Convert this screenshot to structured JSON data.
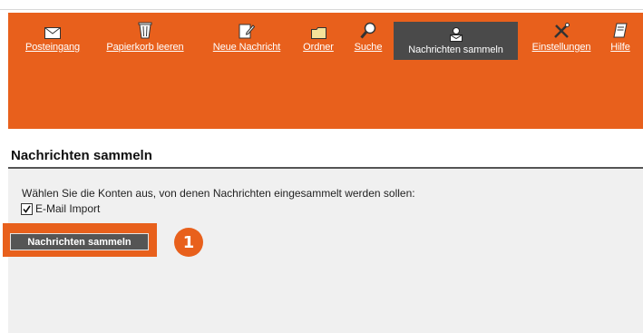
{
  "toolbar": {
    "items": [
      {
        "label": "Posteingang",
        "icon": "envelope-icon"
      },
      {
        "label": "Papierkorb leeren",
        "icon": "trash-icon"
      },
      {
        "label": "Neue Nachricht",
        "icon": "compose-icon"
      },
      {
        "label": "Ordner",
        "icon": "folder-icon"
      },
      {
        "label": "Suche",
        "icon": "magnifier-icon"
      },
      {
        "label": "Nachrichten sammeln",
        "icon": "collect-mail-icon",
        "active": true
      },
      {
        "label": "Einstellungen",
        "icon": "tools-icon"
      },
      {
        "label": "Hilfe",
        "icon": "help-book-icon"
      }
    ]
  },
  "page": {
    "title": "Nachrichten sammeln",
    "description": "Wählen Sie die Konten aus, von denen Nachrichten eingesammelt werden sollen:",
    "account": {
      "label": "E-Mail Import",
      "checked": true
    },
    "collect_button": "Nachrichten sammeln"
  },
  "annotation": {
    "step": "1"
  },
  "colors": {
    "accent": "#e8601c",
    "active_tab": "#4a4a4a",
    "panel": "#f0f0f0",
    "button": "#555555"
  }
}
